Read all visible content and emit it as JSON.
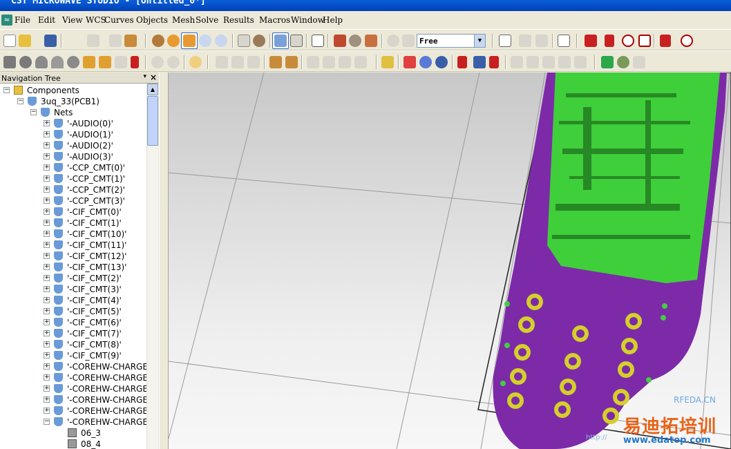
{
  "window": {
    "title": "CST MICROWAVE STUDIO - [Untitled_0*]"
  },
  "menu": [
    "File",
    "Edit",
    "View",
    "WCS",
    "Curves",
    "Objects",
    "Mesh",
    "Solve",
    "Results",
    "Macros",
    "Window",
    "Help"
  ],
  "toolbar": {
    "mode_select": "Free"
  },
  "navigation_tree": {
    "title": "Navigation Tree",
    "close": "×",
    "pin": "▾",
    "components": "Components",
    "pcb": "3uq_33(PCB1)",
    "nets": "Nets",
    "net_items": [
      "'-AUDIO(0)'",
      "'-AUDIO(1)'",
      "'-AUDIO(2)'",
      "'-AUDIO(3)'",
      "'-CCP_CMT(0)'",
      "'-CCP_CMT(1)'",
      "'-CCP_CMT(2)'",
      "'-CCP_CMT(3)'",
      "'-CIF_CMT(0)'",
      "'-CIF_CMT(1)'",
      "'-CIF_CMT(10)'",
      "'-CIF_CMT(11)'",
      "'-CIF_CMT(12)'",
      "'-CIF_CMT(13)'",
      "'-CIF_CMT(2)'",
      "'-CIF_CMT(3)'",
      "'-CIF_CMT(4)'",
      "'-CIF_CMT(5)'",
      "'-CIF_CMT(6)'",
      "'-CIF_CMT(7)'",
      "'-CIF_CMT(8)'",
      "'-CIF_CMT(9)'",
      "'-COREHW-CHARGE_",
      "'-COREHW-CHARGE_",
      "'-COREHW-CHARGE_",
      "'-COREHW-CHARGE_",
      "'-COREHW-CHARGE_",
      "'-COREHW-CHARGE_"
    ],
    "sub_items": [
      "06_3",
      "08_4"
    ]
  },
  "watermark": {
    "site": "RFEDA.CN",
    "brand": "易迪拓培训",
    "url": "www.edatop.com",
    "small": "http://"
  },
  "colors": {
    "pcb_green": "#3fcf3a",
    "pcb_purple": "#7d2aa8",
    "pad_yellow": "#d4cf2a"
  }
}
